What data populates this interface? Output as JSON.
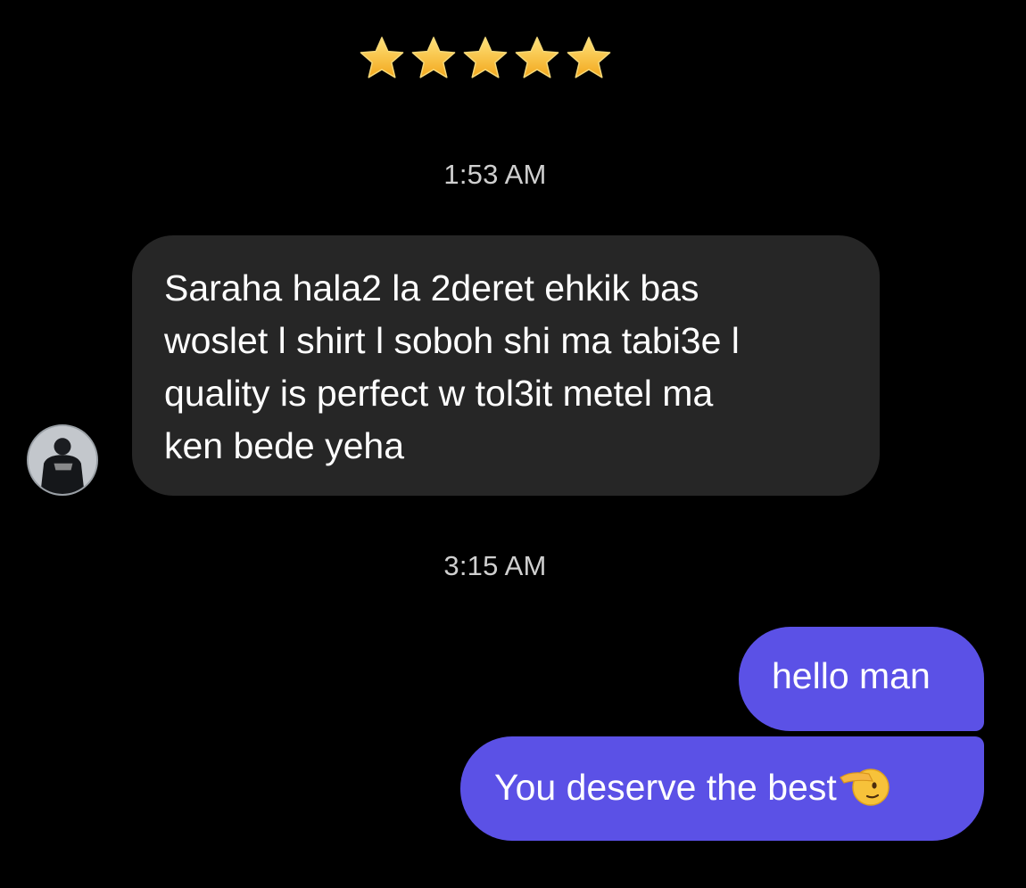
{
  "rating": {
    "stars": 5,
    "max": 5,
    "icon": "star-icon",
    "color": "#f7c12a"
  },
  "timestamps": {
    "first": "1:53 AM",
    "second": "3:15 AM"
  },
  "incoming": {
    "text": "Saraha hala2 la 2deret ehkik bas\nwoslet l shirt l soboh shi ma tabi3e l\nquality is perfect w tol3it metel ma\nken bede yeha",
    "avatar_icon": "user-avatar",
    "bubble_color": "#262626"
  },
  "outgoing": {
    "bubble_color": "#5b51e6",
    "messages": [
      {
        "text": "hello man"
      },
      {
        "text": "You deserve the best",
        "emoji": "saluting-face-icon"
      }
    ]
  }
}
